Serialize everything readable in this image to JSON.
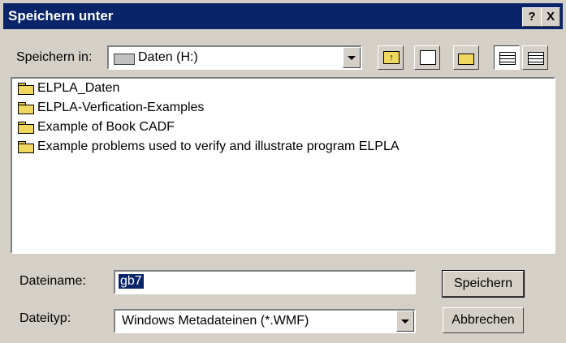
{
  "window": {
    "title": "Speichern unter",
    "help_label": "?",
    "close_label": "X"
  },
  "location": {
    "label": "Speichern in:",
    "value": "Daten (H:)"
  },
  "files": [
    "ELPLA_Daten",
    "ELPLA-Verfication-Examples",
    "Example of Book CADF",
    "Example problems used to verify and illustrate program ELPLA"
  ],
  "filename": {
    "label": "Dateiname:",
    "value": "gb7"
  },
  "filetype": {
    "label": "Dateityp:",
    "value": "Windows Metadateinen (*.WMF)"
  },
  "buttons": {
    "save": "Speichern",
    "cancel": "Abbrechen"
  },
  "colors": {
    "titlebar": "#0a246a",
    "face": "#d4d0c8"
  },
  "icons": [
    "up-folder-icon",
    "desktop-icon",
    "new-folder-icon",
    "list-view-icon",
    "details-view-icon",
    "drive-icon",
    "folder-icon"
  ]
}
